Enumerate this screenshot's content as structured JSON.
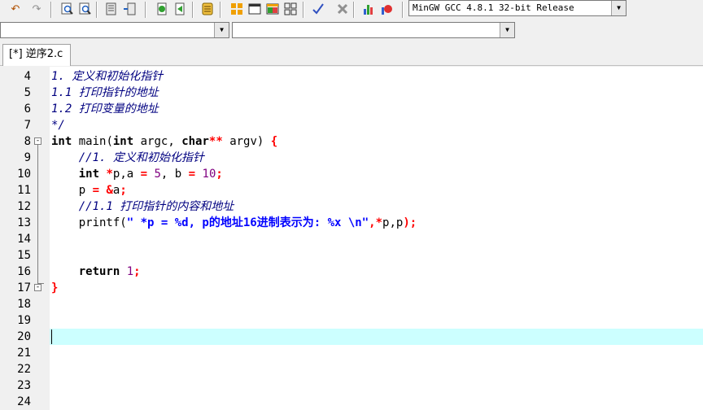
{
  "toolbar": {
    "compiler_select": "MinGW GCC 4.8.1 32-bit Release",
    "icons": [
      "undo-icon",
      "redo-icon",
      "find-icon",
      "replace-icon",
      "compile-icon",
      "run-icon",
      "compile-run-icon",
      "rebuild-icon",
      "indent-icon",
      "unindent-icon",
      "comment-icon",
      "new-project-icon",
      "window-icon",
      "class-icon",
      "grid-icon",
      "check-icon",
      "stop-icon",
      "chart-icon",
      "debug-icon"
    ]
  },
  "selectors": {
    "scope_select": "",
    "symbol_select": ""
  },
  "tab": {
    "label": "[*] 逆序2.c"
  },
  "editor": {
    "line_numbers": [
      "4",
      "5",
      "6",
      "7",
      "8",
      "9",
      "10",
      "11",
      "12",
      "13",
      "14",
      "15",
      "16",
      "17",
      "18",
      "19",
      "20",
      "21",
      "22",
      "23",
      "24"
    ],
    "lines": {
      "l4": "1. 定义和初始化指针",
      "l5": "1.1 打印指针的地址",
      "l6": "1.2 打印变量的地址",
      "l7": "*/",
      "l8": {
        "kw_int": "int",
        "fn": " main(",
        "kw_int2": "int",
        "argc": " argc, ",
        "kw_char": "char",
        "stars": "**",
        "argv": " argv) ",
        "brace": "{"
      },
      "l9": "    //1. 定义和初始化指针",
      "l10": {
        "indent": "    ",
        "kw": "int",
        "sp": " ",
        "star": "*",
        "p": "p,a ",
        "eq1": "=",
        "sp1": " ",
        "five": "5",
        "comma": ", b ",
        "eq2": "=",
        "sp2": " ",
        "ten": "10",
        "semi": ";"
      },
      "l11": {
        "indent": "    p ",
        "eq": "=",
        "sp": " ",
        "amp": "&",
        "a": "a",
        "semi": ";"
      },
      "l12": "    //1.1 打印指针的内容和地址",
      "l13": {
        "fn": "    printf(",
        "str": "\" *p = %d, p的地址16进制表示为: %x \\n\"",
        "c1": ",",
        "star": "*",
        "rest": "p,p",
        "close": ");"
      },
      "l16": {
        "indent": "    ",
        "kw": "return",
        "sp": " ",
        "one": "1",
        "semi": ";"
      },
      "l17": "}"
    },
    "fold_markers": [
      "-",
      "-"
    ]
  }
}
